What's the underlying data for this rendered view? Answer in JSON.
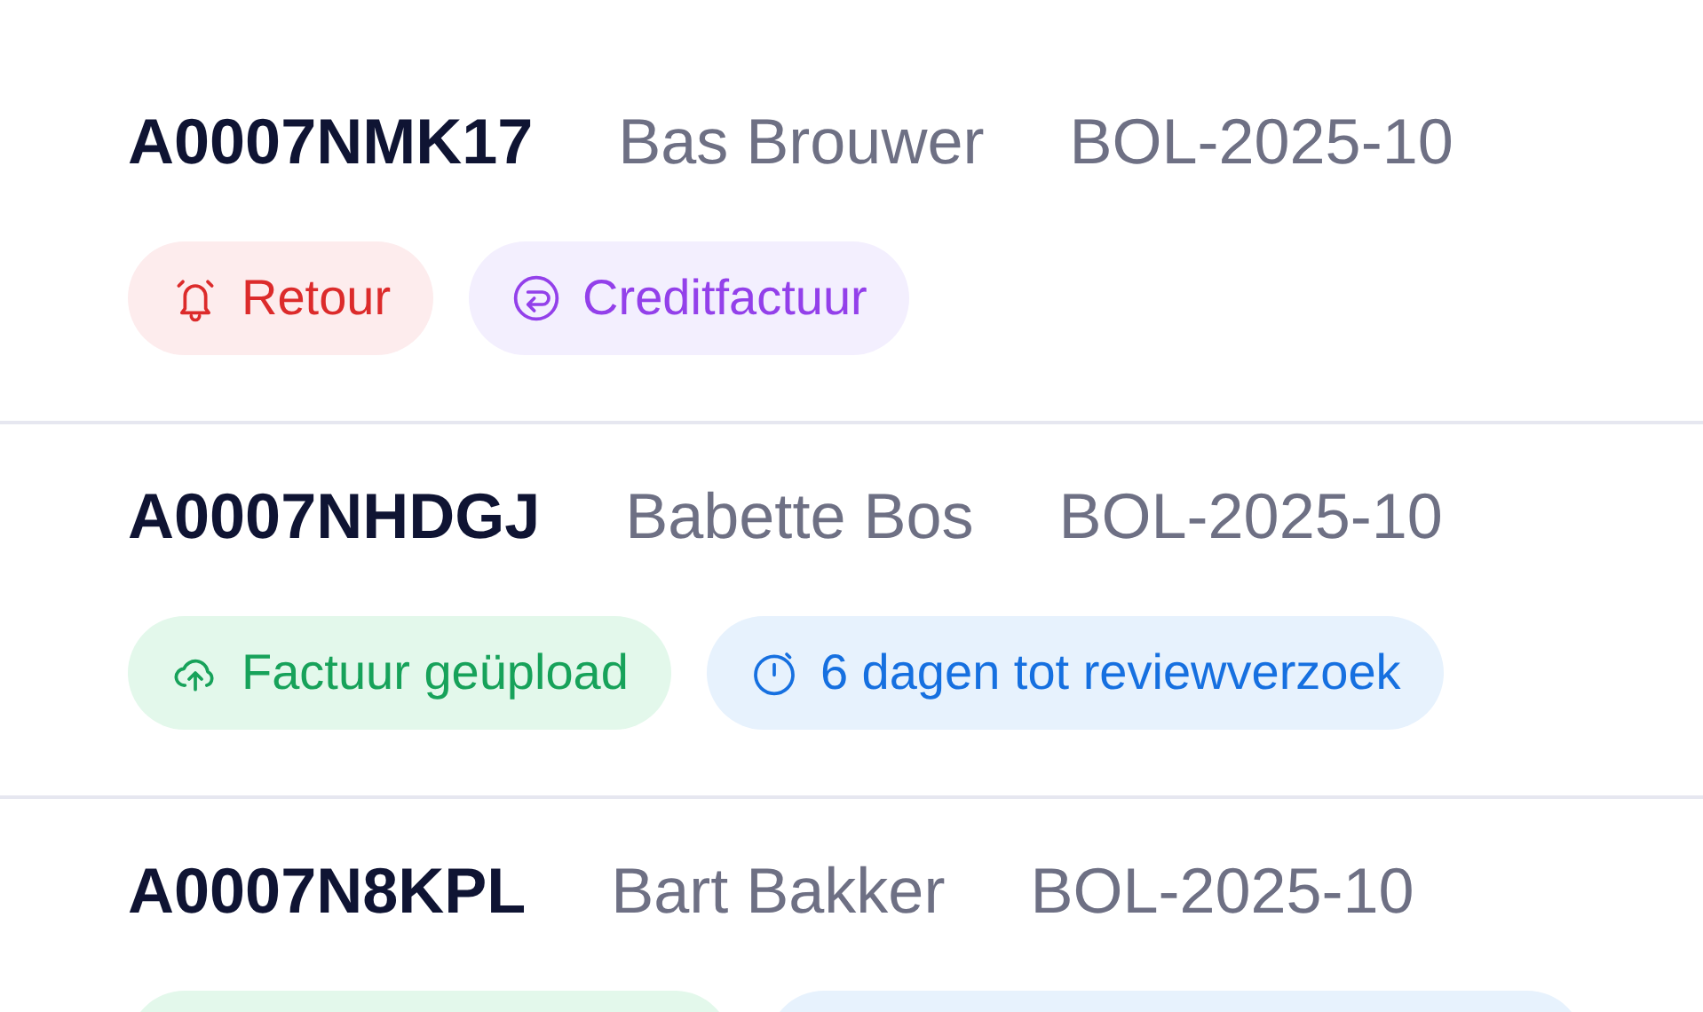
{
  "orders": [
    {
      "order_id": "A0007NMK17",
      "customer": "Bas Brouwer",
      "reference": "BOL-2025-10",
      "tags": [
        {
          "kind": "return",
          "label": "Retour"
        },
        {
          "kind": "credit",
          "label": "Creditfactuur"
        }
      ]
    },
    {
      "order_id": "A0007NHDGJ",
      "customer": "Babette Bos",
      "reference": "BOL-2025-10",
      "tags": [
        {
          "kind": "uploaded",
          "label": "Factuur geüpload"
        },
        {
          "kind": "timer",
          "label": "6 dagen tot reviewverzoek"
        }
      ]
    },
    {
      "order_id": "A0007N8KPL",
      "customer": "Bart Bakker",
      "reference": "BOL-2025-10",
      "tags": [
        {
          "kind": "uploaded"
        },
        {
          "kind": "timer"
        }
      ]
    }
  ]
}
